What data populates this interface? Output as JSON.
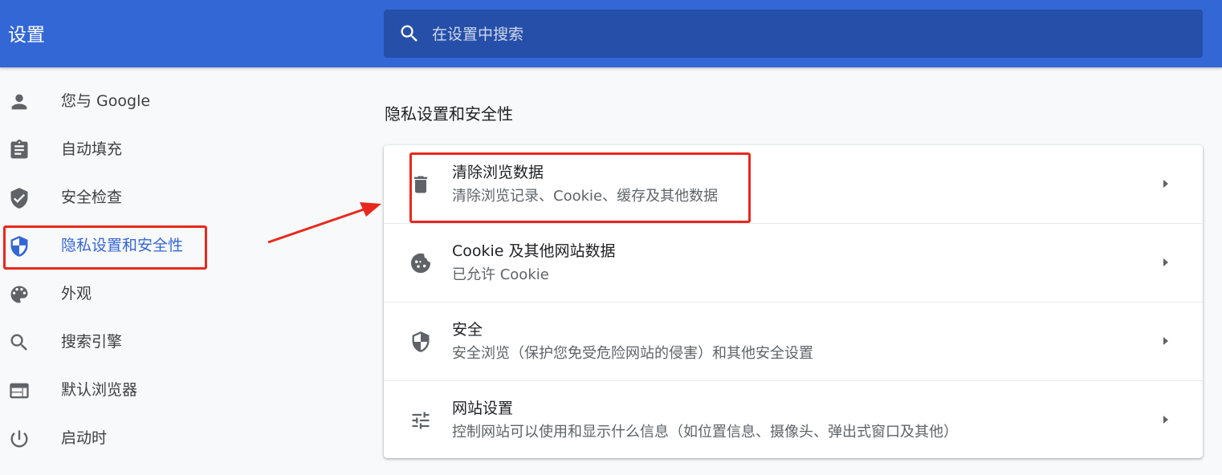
{
  "header": {
    "title": "设置",
    "search_placeholder": "在设置中搜索",
    "search_value": ""
  },
  "sidebar": {
    "items": [
      {
        "label": "您与 Google",
        "icon": "person-icon"
      },
      {
        "label": "自动填充",
        "icon": "clipboard-icon"
      },
      {
        "label": "安全检查",
        "icon": "shield-check-icon"
      },
      {
        "label": "隐私设置和安全性",
        "icon": "shield-icon",
        "selected": true
      },
      {
        "label": "外观",
        "icon": "palette-icon"
      },
      {
        "label": "搜索引擎",
        "icon": "search-icon"
      },
      {
        "label": "默认浏览器",
        "icon": "browser-icon"
      },
      {
        "label": "启动时",
        "icon": "power-icon"
      }
    ]
  },
  "main": {
    "section_title": "隐私设置和安全性",
    "rows": [
      {
        "title": "清除浏览数据",
        "subtitle": "清除浏览记录、Cookie、缓存及其他数据",
        "icon": "trash-icon"
      },
      {
        "title": "Cookie 及其他网站数据",
        "subtitle": "已允许 Cookie",
        "icon": "cookie-icon"
      },
      {
        "title": "安全",
        "subtitle": "安全浏览（保护您免受危险网站的侵害）和其他安全设置",
        "icon": "security-shield-icon"
      },
      {
        "title": "网站设置",
        "subtitle": "控制网站可以使用和显示什么信息（如位置信息、摄像头、弹出式窗口及其他）",
        "icon": "tune-icon"
      }
    ]
  },
  "colors": {
    "header_bg": "#3367d6",
    "search_bg": "#254fa8",
    "accent": "#3367d6",
    "annotation_red": "#e8281e"
  }
}
